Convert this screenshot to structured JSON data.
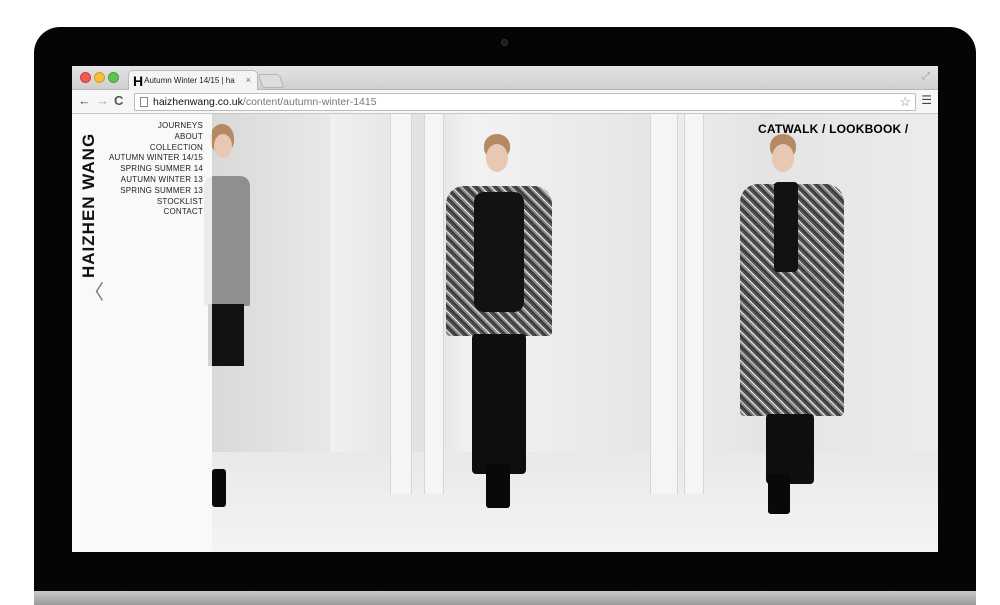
{
  "browser": {
    "tab": {
      "favicon": "H",
      "title": "Autumn Winter 14/15 | ha",
      "close": "×"
    },
    "toolbar": {
      "back": "←",
      "forward": "→",
      "reload": "C",
      "url_host": "haizhenwang.co.uk",
      "url_path": "/content/autumn-winter-1415",
      "star": "☆",
      "menu": "☰"
    }
  },
  "site": {
    "brand": "HAIZHEN WANG",
    "back_arrow": "〈",
    "nav": [
      "JOURNEYS",
      "ABOUT",
      "COLLECTION",
      "AUTUMN WINTER 14/15",
      "SPRING SUMMER 14",
      "AUTUMN WINTER 13",
      "SPRING SUMMER 13",
      "STOCKLIST",
      "CONTACT"
    ],
    "top_nav": "CATWALK / LOOKBOOK /"
  },
  "icons": {
    "favicon": "h-logo-icon",
    "back": "arrow-left-icon",
    "forward": "arrow-right-icon",
    "reload": "reload-icon",
    "page": "page-icon",
    "star": "star-icon",
    "menu": "hamburger-menu-icon",
    "fullscreen": "fullscreen-icon",
    "back_arrow": "chevron-left-icon"
  },
  "colors": {
    "traffic_close": "#ef5b4f",
    "traffic_minimize": "#f7bd3a",
    "traffic_maximize": "#5fc452"
  }
}
